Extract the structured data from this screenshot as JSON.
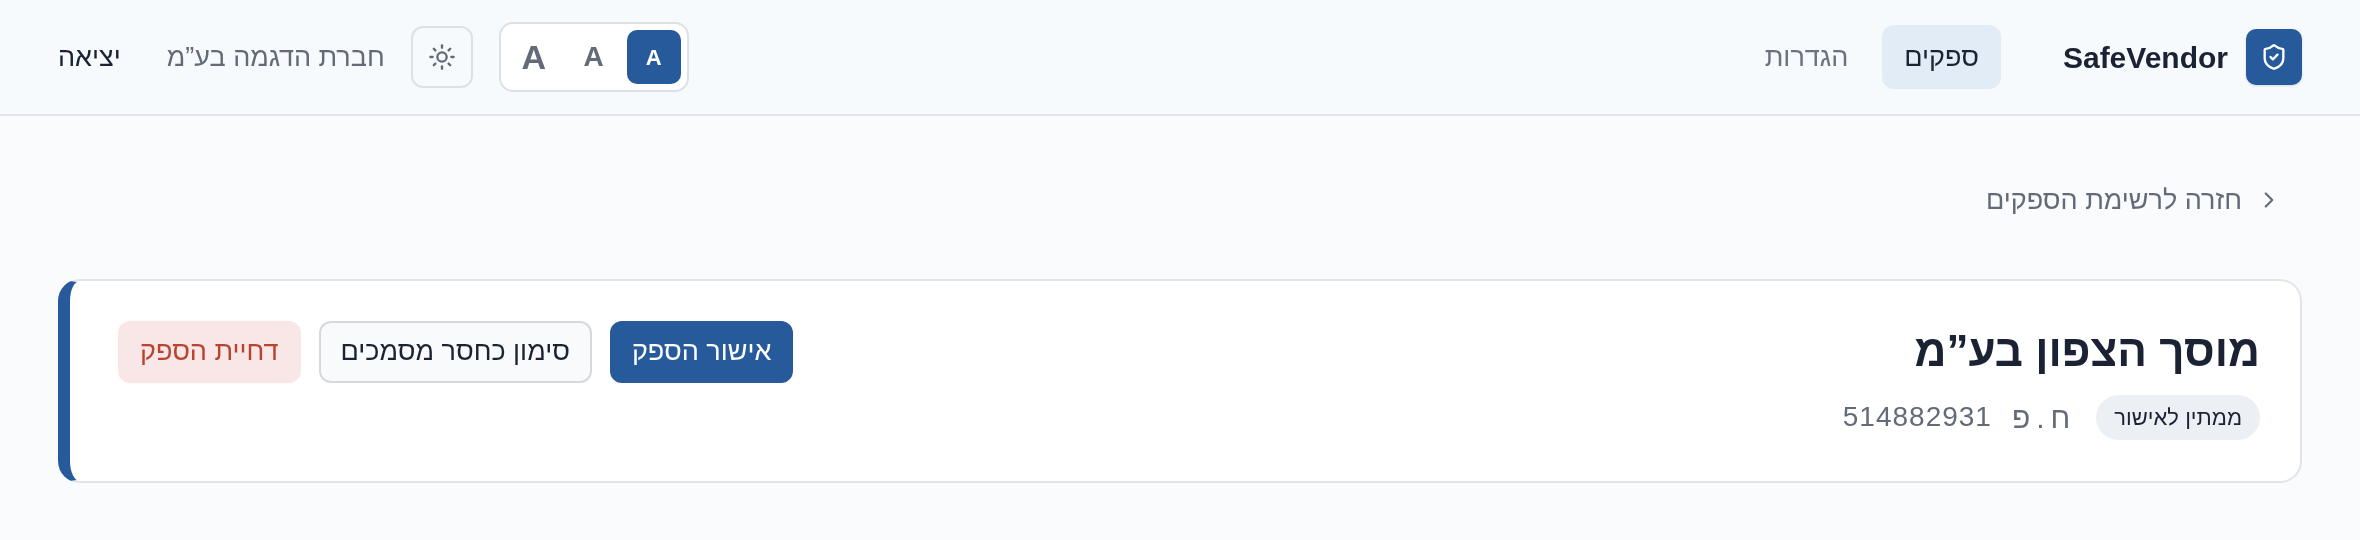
{
  "brand": {
    "name": "SafeVendor"
  },
  "nav": [
    {
      "label": "ספקים",
      "selected": true
    },
    {
      "label": "הגדרות",
      "selected": false
    }
  ],
  "font_size_options": [
    {
      "label": "A",
      "selected": true
    },
    {
      "label": "A",
      "selected": false
    },
    {
      "label": "A",
      "selected": false
    }
  ],
  "company": "חברת הדגמה בע”מ",
  "logout": "יציאה",
  "back_link": "חזרה לרשימת הספקים",
  "vendor": {
    "name": "מוסך הצפון בע”מ",
    "status": "ממתין לאישור",
    "id_label": "ח.פ",
    "id": "514882931"
  },
  "actions": [
    {
      "label": "אישור הספק",
      "kind": "primary"
    },
    {
      "label": "סימון כחסר מסמכים",
      "kind": "secondary"
    },
    {
      "label": "דחיית הספק",
      "kind": "danger"
    }
  ]
}
